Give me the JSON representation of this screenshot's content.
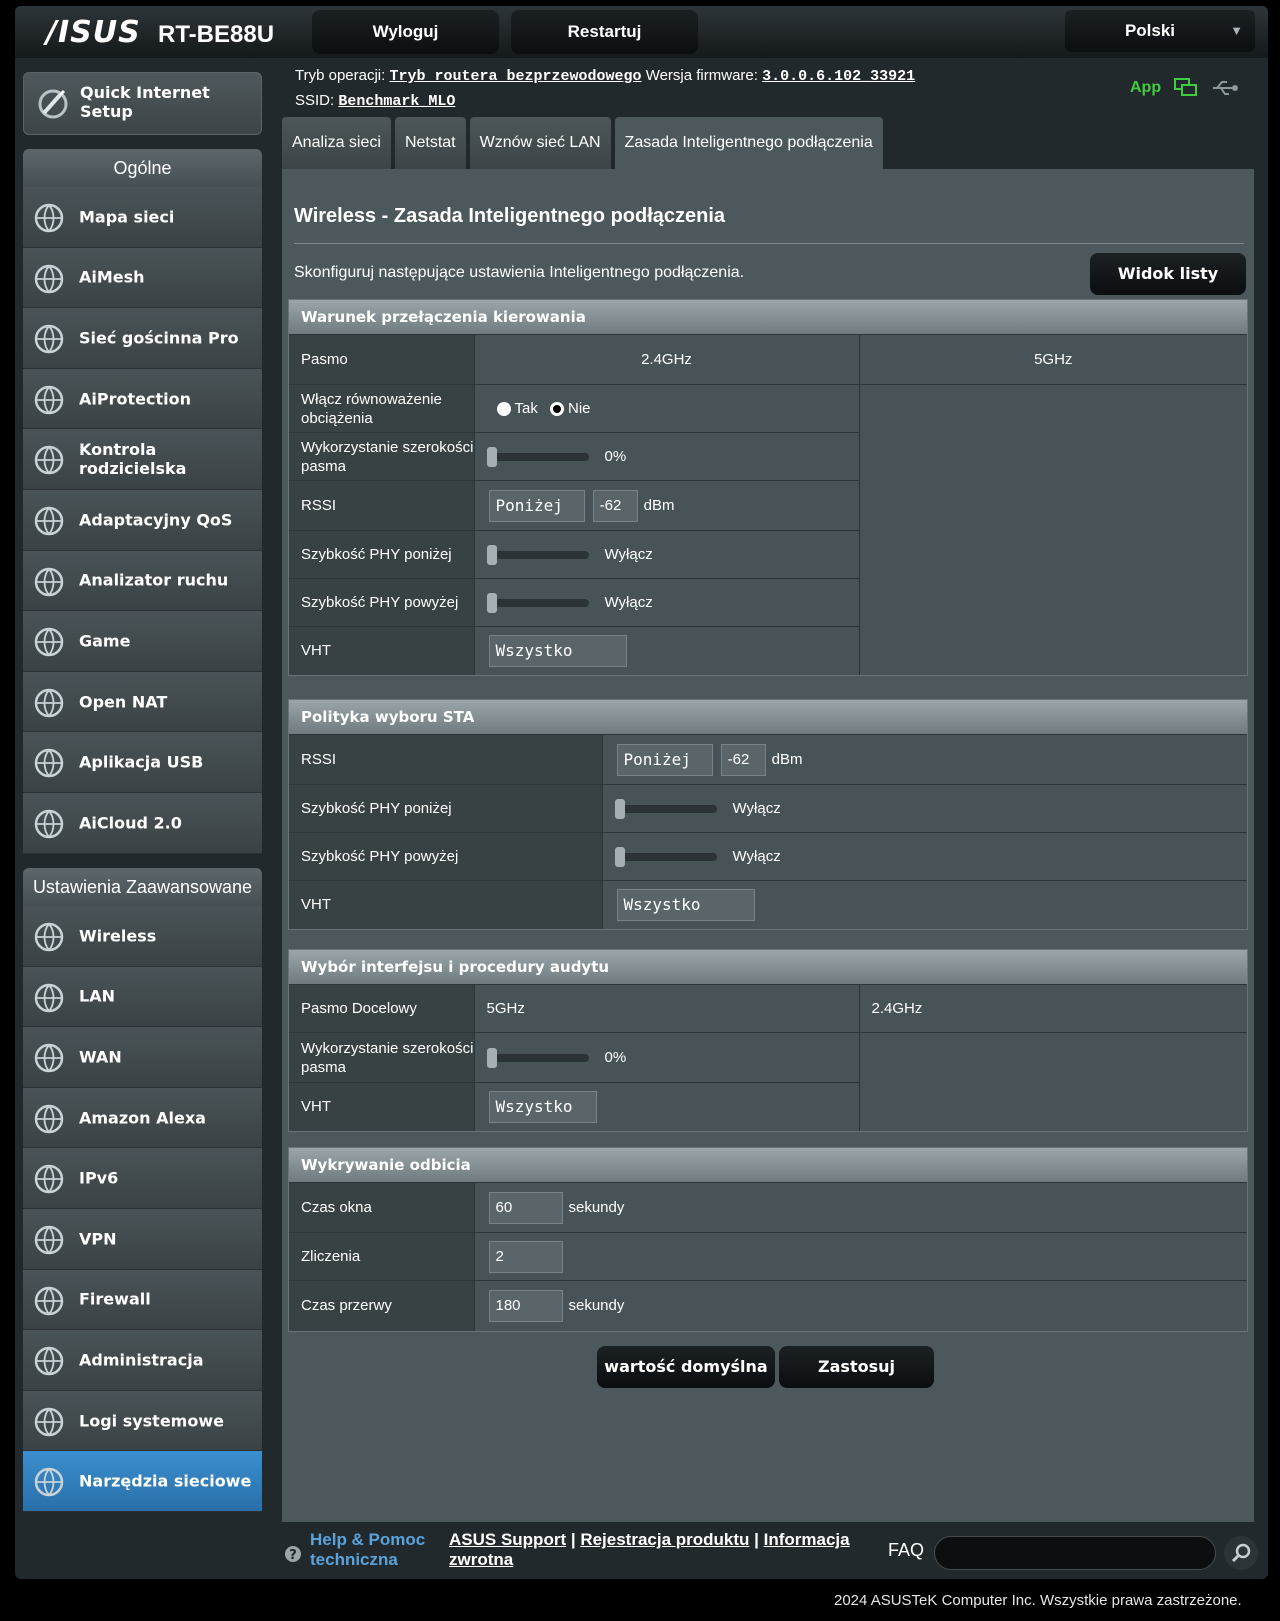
{
  "header": {
    "logo": "/ISUS",
    "model": "RT-BE88U",
    "logout": "Wyloguj",
    "restart": "Restartuj",
    "language": "Polski"
  },
  "info": {
    "mode_label": "Tryb operacji:",
    "mode_value": "Tryb routera bezprzewodowego",
    "fw_label": "Wersja firmware:",
    "fw_value": "3.0.0.6.102_33921",
    "ssid_label": "SSID:",
    "ssid_value": "Benchmark_MLO",
    "app": "App"
  },
  "sidebar": {
    "qis": "Quick Internet Setup",
    "general_head": "Ogólne",
    "general": [
      {
        "label": "Mapa sieci",
        "icon": "globe-icon"
      },
      {
        "label": "AiMesh",
        "icon": "mesh-icon"
      },
      {
        "label": "Sieć gościnna Pro",
        "icon": "guest-network-icon"
      },
      {
        "label": "AiProtection",
        "icon": "shield-icon"
      },
      {
        "label": "Kontrola rodzicielska",
        "icon": "parental-control-icon"
      },
      {
        "label": "Adaptacyjny QoS",
        "icon": "gauge-icon"
      },
      {
        "label": "Analizator ruchu",
        "icon": "traffic-analyzer-icon"
      },
      {
        "label": "Game",
        "icon": "gamepad-icon"
      },
      {
        "label": "Open NAT",
        "icon": "open-nat-icon"
      },
      {
        "label": "Aplikacja USB",
        "icon": "usb-icon"
      },
      {
        "label": "AiCloud 2.0",
        "icon": "cloud-icon"
      }
    ],
    "advanced_head": "Ustawienia Zaawansowane",
    "advanced": [
      {
        "label": "Wireless",
        "icon": "wireless-icon"
      },
      {
        "label": "LAN",
        "icon": "lan-icon"
      },
      {
        "label": "WAN",
        "icon": "wan-globe-icon"
      },
      {
        "label": "Amazon Alexa",
        "icon": "alexa-icon"
      },
      {
        "label": "IPv6",
        "icon": "ipv6-icon"
      },
      {
        "label": "VPN",
        "icon": "vpn-icon"
      },
      {
        "label": "Firewall",
        "icon": "firewall-icon"
      },
      {
        "label": "Administracja",
        "icon": "admin-gear-icon"
      },
      {
        "label": "Logi systemowe",
        "icon": "system-log-icon"
      },
      {
        "label": "Narzędzia sieciowe",
        "icon": "network-tools-icon"
      }
    ]
  },
  "tabs": [
    "Analiza sieci",
    "Netstat",
    "Wznów sieć LAN",
    "Zasada Inteligentnego podłączenia"
  ],
  "page": {
    "title": "Wireless - Zasada Inteligentnego podłączenia",
    "desc": "Skonfiguruj następujące ustawienia Inteligentnego podłączenia.",
    "list_view": "Widok listy"
  },
  "s1": {
    "title": "Warunek przełączenia kierowania",
    "band_label": "Pasmo",
    "band_24": "2.4GHz",
    "band_5": "5GHz",
    "lb_label": "Włącz równoważenie obciążenia",
    "yes": "Tak",
    "no": "Nie",
    "bw_label": "Wykorzystanie szerokości pasma",
    "bw_value": "0%",
    "rssi_label": "RSSI",
    "rssi_cond": "Poniżej",
    "rssi_value": "-62",
    "rssi_unit": "dBm",
    "phy_below_label": "Szybkość PHY poniżej",
    "phy_below_value": "Wyłącz",
    "phy_above_label": "Szybkość PHY powyżej",
    "phy_above_value": "Wyłącz",
    "vht_label": "VHT",
    "vht_value": "Wszystko"
  },
  "s2": {
    "title": "Polityka wyboru STA",
    "rssi_label": "RSSI",
    "rssi_cond": "Poniżej",
    "rssi_value": "-62",
    "rssi_unit": "dBm",
    "phy_below_label": "Szybkość PHY poniżej",
    "phy_below_value": "Wyłącz",
    "phy_above_label": "Szybkość PHY powyżej",
    "phy_above_value": "Wyłącz",
    "vht_label": "VHT",
    "vht_value": "Wszystko"
  },
  "s3": {
    "title": "Wybór interfejsu i procedury audytu",
    "target_label": "Pasmo Docelowy",
    "target_1": "5GHz",
    "target_2": "2.4GHz",
    "bw_label": "Wykorzystanie szerokości pasma",
    "bw_value": "0%",
    "vht_label": "VHT",
    "vht_value": "Wszystko"
  },
  "s4": {
    "title": "Wykrywanie odbicia",
    "window_label": "Czas okna",
    "window_value": "60",
    "window_unit": "sekundy",
    "count_label": "Zliczenia",
    "count_value": "2",
    "break_label": "Czas przerwy",
    "break_value": "180",
    "break_unit": "sekundy"
  },
  "actions": {
    "default": "wartość domyślna",
    "apply": "Zastosuj"
  },
  "footer": {
    "help1": "Help & Pomoc",
    "help2": "techniczna",
    "support": "ASUS Support",
    "register": "Rejestracja produktu",
    "feedback1": "Informacja",
    "feedback2": "zwrotna",
    "faq": "FAQ",
    "copyright": "2024 ASUSTeK Computer Inc. Wszystkie prawa zastrzeżone."
  },
  "colors": {
    "accent_active": "#2f80c0",
    "app_green": "#3fcc3f",
    "help_blue": "#5aa2db"
  }
}
